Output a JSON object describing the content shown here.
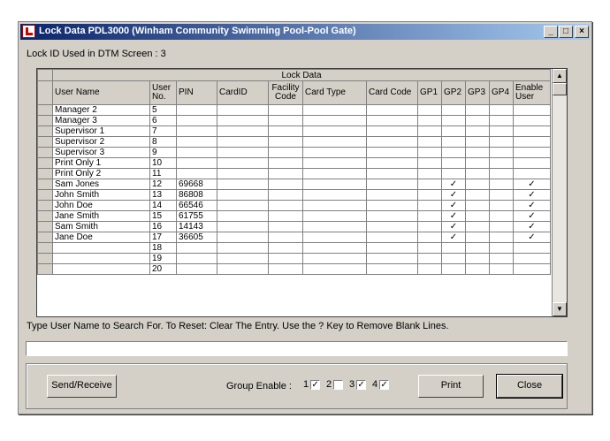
{
  "window": {
    "title": "Lock Data PDL3000 (Winham Community Swimming Pool-Pool Gate)",
    "controls": [
      "_",
      "□",
      "×"
    ]
  },
  "lock_id_label": "Lock ID Used in DTM Screen : 3",
  "grid": {
    "group_header": "Lock Data",
    "columns": [
      "User Name",
      "User No.",
      "PIN",
      "CardID",
      "Facility Code",
      "Card Type",
      "Card Code",
      "GP1",
      "GP2",
      "GP3",
      "GP4",
      "Enable User"
    ],
    "rows": [
      {
        "name": "Manager 2",
        "no": "5",
        "pin": "",
        "gp2": "",
        "enable": ""
      },
      {
        "name": "Manager 3",
        "no": "6",
        "pin": "",
        "gp2": "",
        "enable": ""
      },
      {
        "name": "Supervisor 1",
        "no": "7",
        "pin": "",
        "gp2": "",
        "enable": ""
      },
      {
        "name": "Supervisor 2",
        "no": "8",
        "pin": "",
        "gp2": "",
        "enable": ""
      },
      {
        "name": "Supervisor 3",
        "no": "9",
        "pin": "",
        "gp2": "",
        "enable": ""
      },
      {
        "name": "Print Only 1",
        "no": "10",
        "pin": "",
        "gp2": "",
        "enable": ""
      },
      {
        "name": "Print Only 2",
        "no": "11",
        "pin": "",
        "gp2": "",
        "enable": ""
      },
      {
        "name": "Sam Jones",
        "no": "12",
        "pin": "69668",
        "gp2": "✓",
        "enable": "✓"
      },
      {
        "name": "John Smith",
        "no": "13",
        "pin": "86808",
        "gp2": "✓",
        "enable": "✓"
      },
      {
        "name": "John Doe",
        "no": "14",
        "pin": "66546",
        "gp2": "✓",
        "enable": "✓"
      },
      {
        "name": "Jane Smith",
        "no": "15",
        "pin": "61755",
        "gp2": "✓",
        "enable": "✓"
      },
      {
        "name": "Sam Smith",
        "no": "16",
        "pin": "14143",
        "gp2": "✓",
        "enable": "✓"
      },
      {
        "name": "Jane Doe",
        "no": "17",
        "pin": "36605",
        "gp2": "✓",
        "enable": "✓"
      },
      {
        "name": "",
        "no": "18",
        "pin": "",
        "gp2": "",
        "enable": ""
      },
      {
        "name": "",
        "no": "19",
        "pin": "",
        "gp2": "",
        "enable": ""
      },
      {
        "name": "",
        "no": "20",
        "pin": "",
        "gp2": "",
        "enable": ""
      }
    ]
  },
  "hint": "Type User Name to Search For. To Reset: Clear The Entry. Use the ? Key to Remove Blank Lines.",
  "search_value": "",
  "buttons": {
    "send_receive": "Send/Receive",
    "print": "Print",
    "close": "Close"
  },
  "group_enable": {
    "label": "Group Enable :",
    "items": [
      {
        "label": "1",
        "checked": "✓"
      },
      {
        "label": "2",
        "checked": ""
      },
      {
        "label": "3",
        "checked": "✓"
      },
      {
        "label": "4",
        "checked": "✓"
      }
    ]
  }
}
